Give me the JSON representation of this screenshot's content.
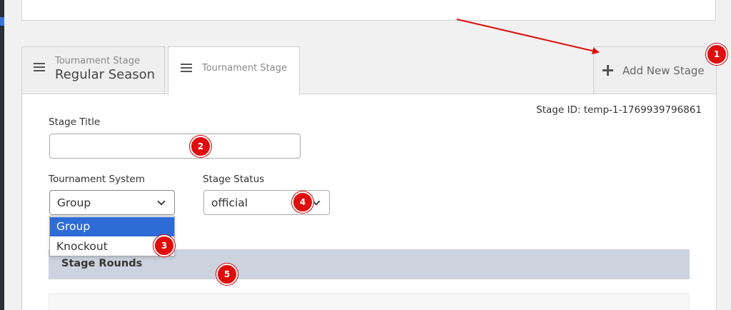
{
  "tabs": [
    {
      "subtitle": "Tournament Stage",
      "title": "Regular Season"
    },
    {
      "label": "Tournament Stage"
    }
  ],
  "add_stage": {
    "label": "Add New Stage"
  },
  "stage_id": "Stage ID: temp-1-1769939796861",
  "form": {
    "title_label": "Stage Title",
    "title_value": "",
    "system_label": "Tournament System",
    "system_value": "Group",
    "system_options": [
      "Group",
      "Knockout"
    ],
    "status_label": "Stage Status",
    "status_value": "official"
  },
  "rounds": {
    "title": "Stage Rounds"
  },
  "annotations": [
    "1",
    "2",
    "3",
    "4",
    "5"
  ],
  "colors": {
    "annotation_red": "#e00d0d",
    "selected_option": "#2d6bd6",
    "rounds_header_bg": "#ccd2de"
  }
}
